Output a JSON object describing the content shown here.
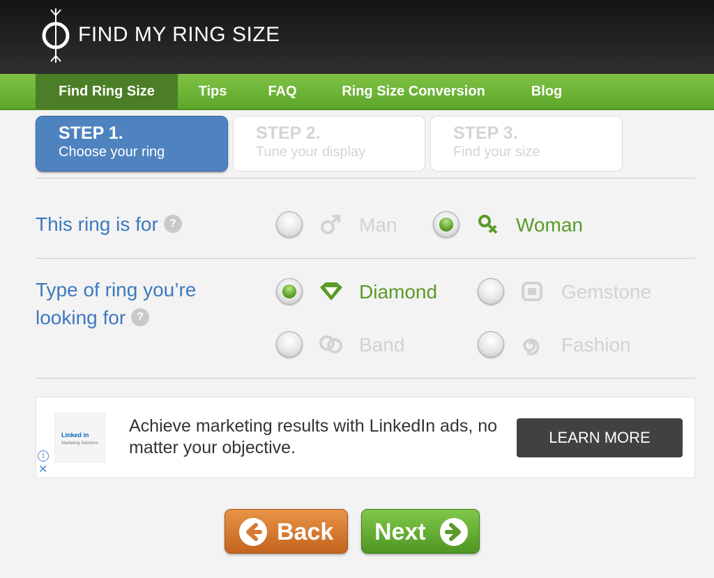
{
  "header": {
    "brand": "FIND MY RING SIZE"
  },
  "nav": {
    "items": [
      {
        "label": "Find Ring Size",
        "active": true
      },
      {
        "label": "Tips"
      },
      {
        "label": "FAQ"
      },
      {
        "label": "Ring Size Conversion"
      },
      {
        "label": "Blog"
      }
    ]
  },
  "steps": [
    {
      "num": "STEP 1.",
      "text": "Choose your ring",
      "active": true
    },
    {
      "num": "STEP 2.",
      "text": "Tune your display"
    },
    {
      "num": "STEP 3.",
      "text": "Find your size"
    }
  ],
  "questions": {
    "ring_for": {
      "label": "This ring is for",
      "help": "?",
      "options": [
        {
          "label": "Man",
          "icon": "male-icon",
          "selected": false
        },
        {
          "label": "Woman",
          "icon": "female-icon",
          "selected": true
        }
      ]
    },
    "ring_type": {
      "label_line1": "Type of ring you’re",
      "label_line2": "looking for",
      "help": "?",
      "options": [
        {
          "label": "Diamond",
          "icon": "diamond-icon",
          "selected": true
        },
        {
          "label": "Gemstone",
          "icon": "gemstone-icon",
          "selected": false
        },
        {
          "label": "Band",
          "icon": "band-icon",
          "selected": false
        },
        {
          "label": "Fashion",
          "icon": "fashion-icon",
          "selected": false
        }
      ]
    }
  },
  "ad": {
    "logo_text": "Linked in",
    "logo_sub": "Marketing Solutions",
    "text": "Achieve marketing results with LinkedIn ads, no matter your objective.",
    "button": "LEARN MORE",
    "info": "i",
    "close": "✕"
  },
  "buttons": {
    "back": "Back",
    "next": "Next"
  },
  "colors": {
    "accent_blue": "#4f83bf",
    "accent_green": "#5a9a28",
    "orange": "#d77a33"
  }
}
